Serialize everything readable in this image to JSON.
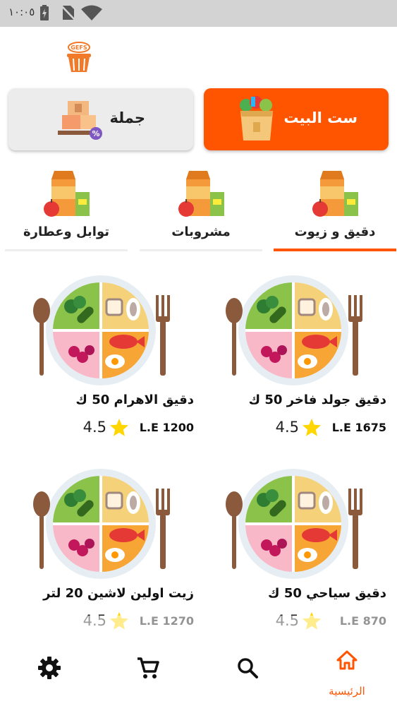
{
  "status_bar": {
    "time": "١٠:٠٥"
  },
  "modes": [
    {
      "label": "ست البيت",
      "active": true
    },
    {
      "label": "جملة",
      "active": false
    }
  ],
  "categories": [
    {
      "label": "دقيق و زيوت",
      "active": true
    },
    {
      "label": "مشروبات",
      "active": false
    },
    {
      "label": "توابل وعطارة",
      "active": false
    }
  ],
  "products": [
    {
      "name": "دقيق جولد فاخر 50 ك",
      "price": "L.E 1675",
      "rating": "4.5"
    },
    {
      "name": "دقيق الاهرام 50 ك",
      "price": "L.E 1200",
      "rating": "4.5"
    },
    {
      "name": "دقيق سياحي 50 ك",
      "price": "L.E 870",
      "rating": "4.5"
    },
    {
      "name": "زيت اولين لاشين 20 لتر",
      "price": "L.E 1270",
      "rating": "4.5"
    }
  ],
  "bottom_nav": [
    {
      "icon": "home-icon",
      "label": "الرئيسية",
      "active": true
    },
    {
      "icon": "search-icon",
      "label": "",
      "active": false
    },
    {
      "icon": "cart-icon",
      "label": "",
      "active": false
    },
    {
      "icon": "settings-icon",
      "label": "",
      "active": false
    }
  ],
  "colors": {
    "accent": "#ff5400",
    "status_bar": "#d3d3d3",
    "card_inactive": "#ececec"
  }
}
